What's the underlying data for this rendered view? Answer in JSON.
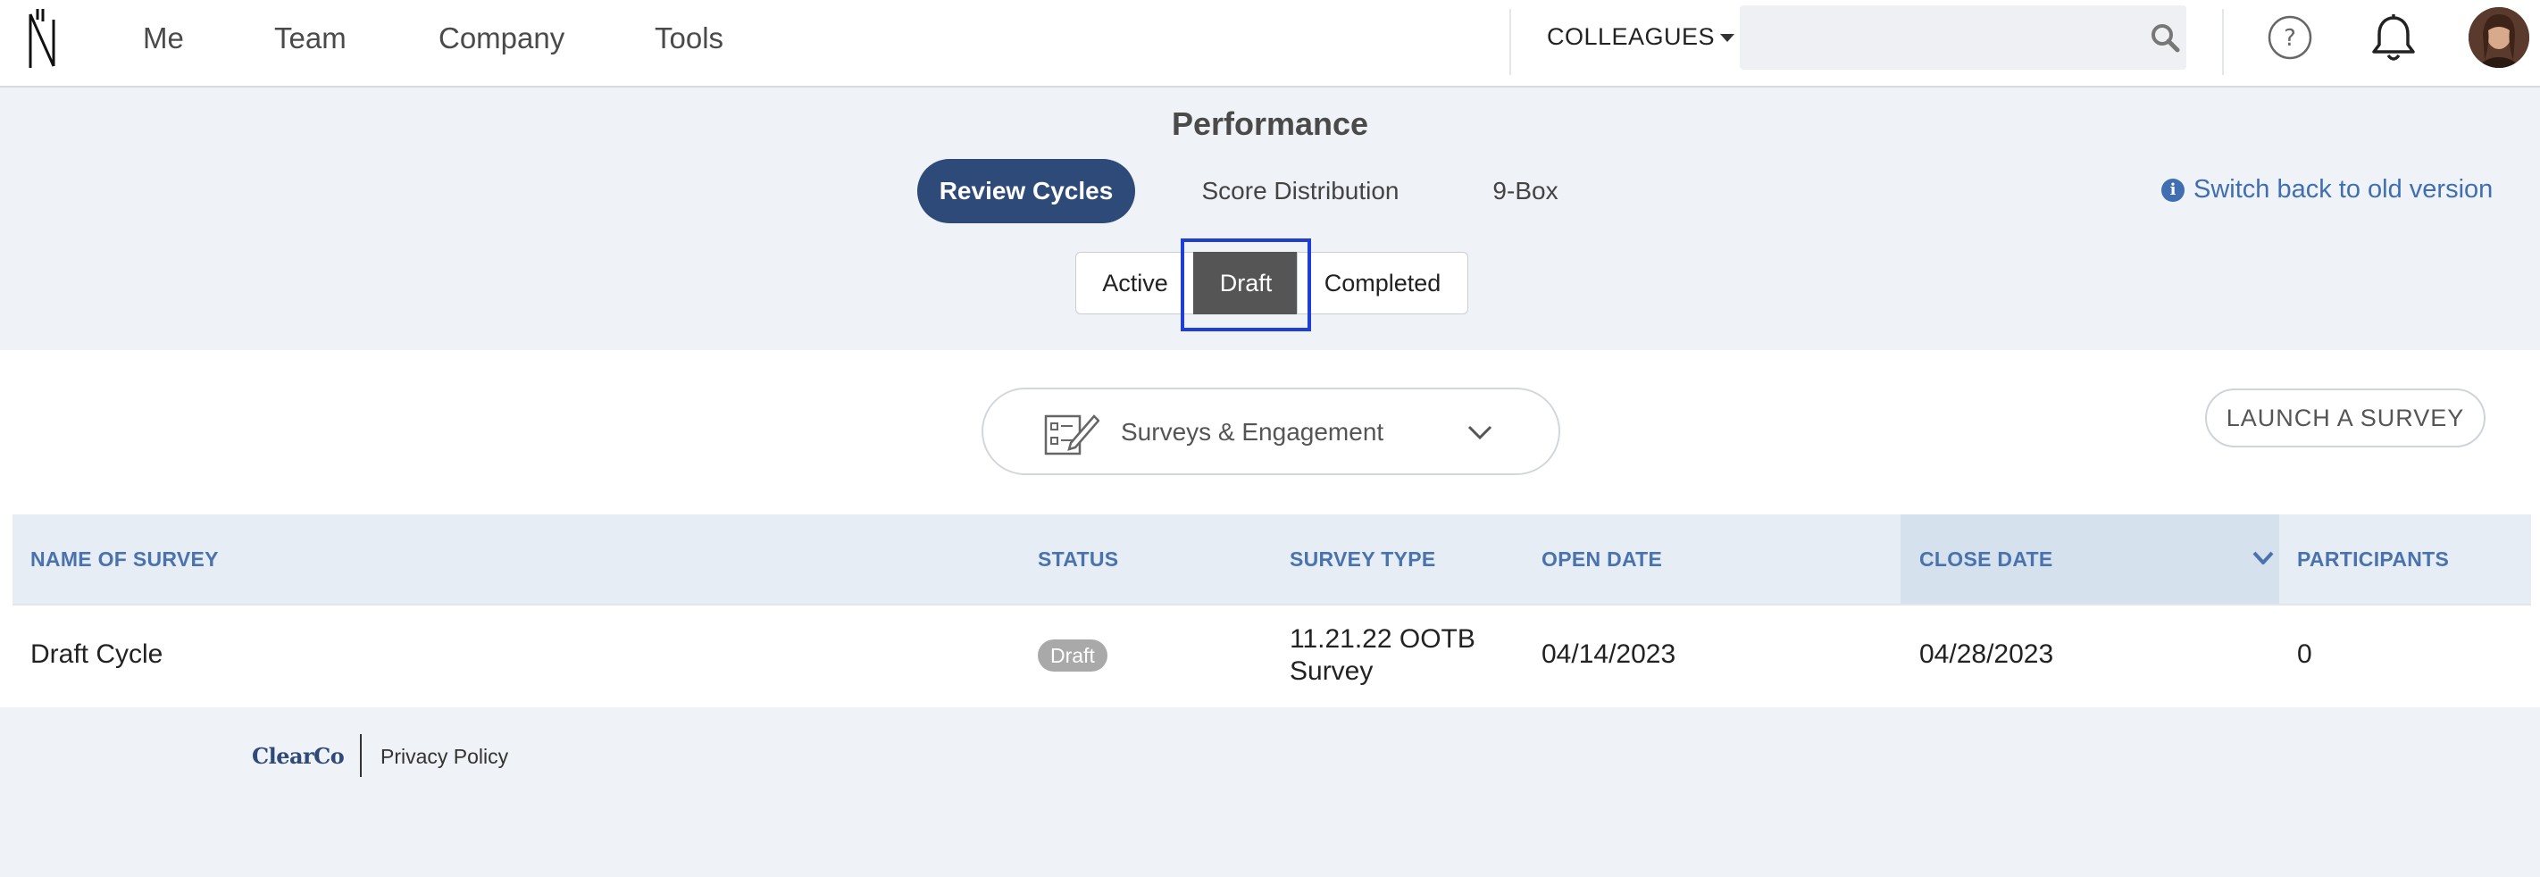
{
  "nav": {
    "items": [
      "Me",
      "Team",
      "Company",
      "Tools"
    ],
    "colleagues_label": "COLLEAGUES",
    "search": {
      "value": "",
      "placeholder": ""
    }
  },
  "page": {
    "title": "Performance",
    "tabs": [
      "Review Cycles",
      "Score Distribution",
      "9-Box"
    ],
    "active_tab": "Review Cycles",
    "switch_link": "Switch back to old version",
    "status_filters": [
      "Active",
      "Draft",
      "Completed"
    ],
    "selected_filter": "Draft"
  },
  "toolbar": {
    "survey_select": "Surveys & Engagement",
    "launch_button": "LAUNCH A SURVEY"
  },
  "table": {
    "columns": [
      "NAME OF SURVEY",
      "STATUS",
      "SURVEY TYPE",
      "OPEN DATE",
      "CLOSE DATE",
      "PARTICIPANTS"
    ],
    "sorted_column": "CLOSE DATE",
    "rows": [
      {
        "name": "Draft Cycle",
        "status": "Draft",
        "survey_type": "11.21.22 OOTB Survey",
        "open_date": "04/14/2023",
        "close_date": "04/28/2023",
        "participants": "0"
      }
    ]
  },
  "footer": {
    "logo": "ClearCo",
    "privacy": "Privacy Policy"
  },
  "colors": {
    "accent": "#2d4a78",
    "link": "#3f6fb0",
    "header_text": "#4a73ae",
    "selected_filter": "#555555",
    "focus_outline": "#1f3ed6"
  }
}
